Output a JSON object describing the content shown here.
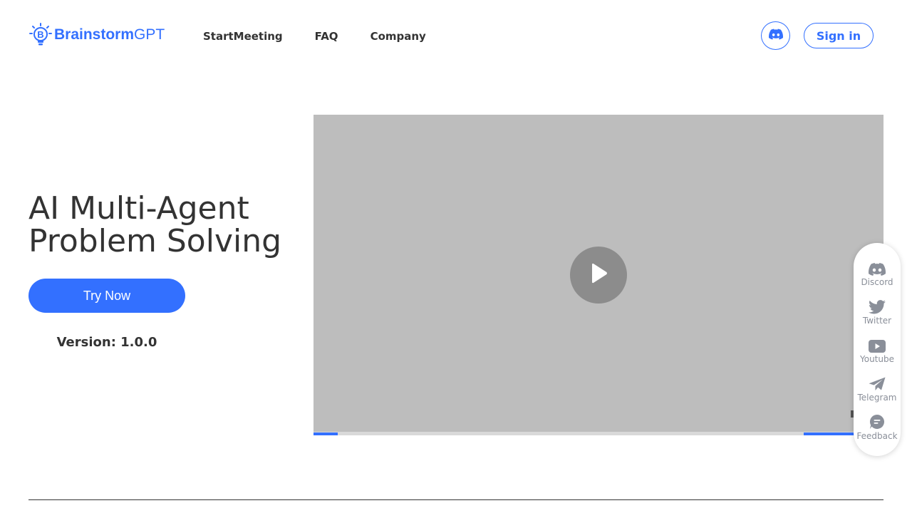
{
  "logo": {
    "brand": "Brainstorm",
    "suffix": "GPT",
    "mark_letter": "B"
  },
  "nav": {
    "items": [
      "StartMeeting",
      "FAQ",
      "Company"
    ]
  },
  "header": {
    "discord_icon": "discord-icon",
    "signin_label": "Sign in"
  },
  "hero": {
    "title_line1": "AI Multi-Agent",
    "title_line2": "Problem Solving",
    "cta_label": "Try Now",
    "version": "Version: 1.0.0"
  },
  "video": {
    "play_icon": "play-icon"
  },
  "social": {
    "items": [
      {
        "label": "Discord",
        "icon": "discord-icon"
      },
      {
        "label": "Twitter",
        "icon": "twitter-icon"
      },
      {
        "label": "Youtube",
        "icon": "youtube-icon"
      },
      {
        "label": "Telegram",
        "icon": "telegram-icon"
      },
      {
        "label": "Feedback",
        "icon": "feedback-icon"
      }
    ]
  },
  "colors": {
    "accent": "#3370ff",
    "text": "#333333",
    "video_bg": "#bdbdbd",
    "social_icon": "#8a8f99"
  }
}
